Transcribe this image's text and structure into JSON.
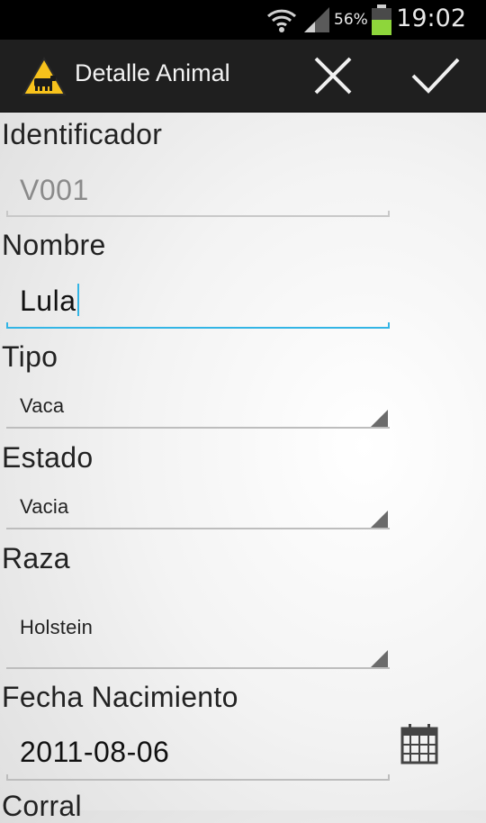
{
  "status_bar": {
    "battery_percent": "56%",
    "time": "19:02",
    "icons": [
      "wifi-icon",
      "signal-icon",
      "battery-icon"
    ]
  },
  "action_bar": {
    "title": "Detalle Animal",
    "logo_icon": "cow-warning-icon",
    "cancel_icon": "close-icon",
    "confirm_icon": "check-icon"
  },
  "form": {
    "identificador": {
      "label": "Identificador",
      "value": "V001"
    },
    "nombre": {
      "label": "Nombre",
      "value": "Lula"
    },
    "tipo": {
      "label": "Tipo",
      "value": "Vaca"
    },
    "estado": {
      "label": "Estado",
      "value": "Vacia"
    },
    "raza": {
      "label": "Raza",
      "value": "Holstein"
    },
    "fecha_nacimiento": {
      "label": "Fecha Nacimiento",
      "value": "2011-08-06",
      "icon": "calendar-icon"
    },
    "corral": {
      "label": "Corral"
    }
  },
  "colors": {
    "accent": "#33b5e5",
    "logo_yellow": "#f7c21c",
    "battery_green": "#8ed63b"
  }
}
